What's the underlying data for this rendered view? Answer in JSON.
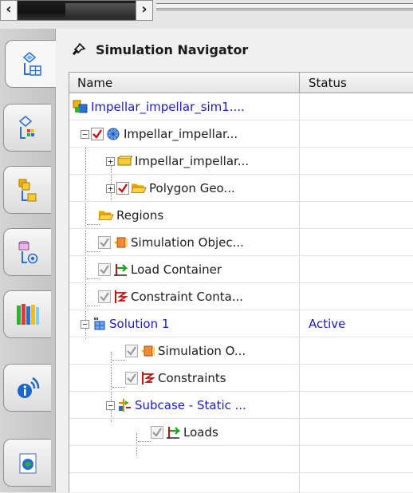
{
  "navigator": {
    "title": "Simulation Navigator",
    "columns": {
      "name": "Name",
      "status": "Status"
    }
  },
  "tree": [
    {
      "label": "Impellar_impellar_sim1....",
      "status": "",
      "color": "blue"
    },
    {
      "label": "Impellar_impellar...",
      "status": "",
      "color": "black"
    },
    {
      "label": "Impellar_impellar...",
      "status": "",
      "color": "black"
    },
    {
      "label": "Polygon Geo...",
      "status": "",
      "color": "black"
    },
    {
      "label": "Regions",
      "status": "",
      "color": "black"
    },
    {
      "label": "Simulation Objec...",
      "status": "",
      "color": "black"
    },
    {
      "label": "Load Container",
      "status": "",
      "color": "black"
    },
    {
      "label": "Constraint Conta...",
      "status": "",
      "color": "black"
    },
    {
      "label": "Solution 1",
      "status": "Active",
      "color": "blue"
    },
    {
      "label": "Simulation O...",
      "status": "",
      "color": "black"
    },
    {
      "label": "Constraints",
      "status": "",
      "color": "black"
    },
    {
      "label": "Subcase - Static ...",
      "status": "",
      "color": "blue"
    },
    {
      "label": "Loads",
      "status": "",
      "color": "black"
    }
  ],
  "tabs": [
    {
      "icon": "simulation-navigator-icon"
    },
    {
      "icon": "simulation-file-view-icon"
    },
    {
      "icon": "assembly-navigator-icon"
    },
    {
      "icon": "part-navigator-icon"
    },
    {
      "icon": "library-icon"
    },
    {
      "icon": "info-broadcast-icon"
    },
    {
      "icon": "history-icon"
    }
  ],
  "colors": {
    "blue_text": "#1a1ad6",
    "check_red": "#d01010",
    "folder": "#f0b400",
    "load_green": "#1aa31a"
  }
}
